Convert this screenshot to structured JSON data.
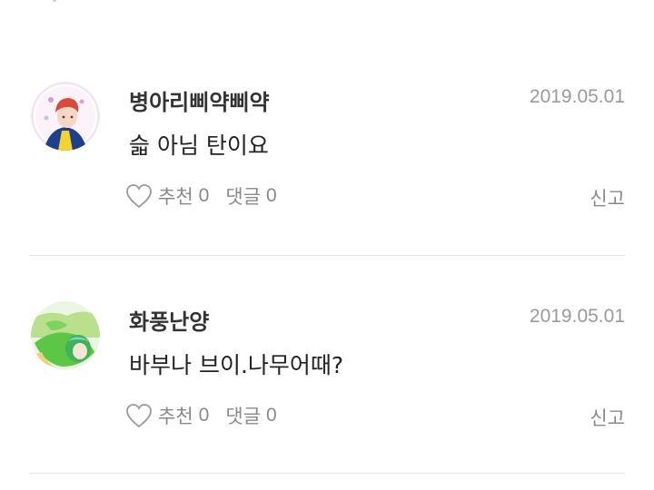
{
  "comments": [
    {
      "username": "병아리삐약삐약",
      "date": "2019.05.01",
      "text": "슯 아님 탄이요",
      "like_label": "추천",
      "like_count": "0",
      "reply_label": "댓글",
      "reply_count": "0",
      "report_label": "신고",
      "avatar_icon": "avatar-illustration-redhair-boy"
    },
    {
      "username": "화풍난양",
      "date": "2019.05.01",
      "text": "바부나 브이.나무어때?",
      "like_label": "추천",
      "like_count": "0",
      "reply_label": "댓글",
      "reply_count": "0",
      "report_label": "신고",
      "avatar_icon": "avatar-illustration-green-figure"
    }
  ],
  "colors": {
    "meta_gray": "#9a9a9a",
    "action_gray": "#8a8a8a",
    "divider": "#e4e4e4",
    "text_dark": "#222222"
  }
}
